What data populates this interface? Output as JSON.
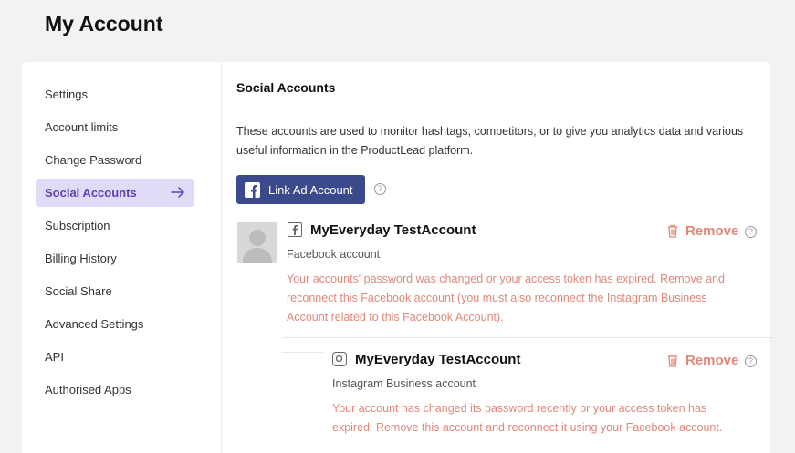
{
  "page": {
    "title": "My Account"
  },
  "sidebar": {
    "items": [
      {
        "label": "Settings"
      },
      {
        "label": "Account limits"
      },
      {
        "label": "Change Password"
      },
      {
        "label": "Social Accounts"
      },
      {
        "label": "Subscription"
      },
      {
        "label": "Billing History"
      },
      {
        "label": "Social Share"
      },
      {
        "label": "Advanced Settings"
      },
      {
        "label": "API"
      },
      {
        "label": "Authorised Apps"
      }
    ]
  },
  "main": {
    "title": "Social Accounts",
    "intro": "These accounts are used to monitor hashtags, competitors, or to give you analytics data and various useful information in the ProductLead platform.",
    "link_button": "Link Ad Account",
    "accounts": [
      {
        "name": "MyEveryday TestAccount",
        "type": "Facebook account",
        "warning": "Your accounts' password was changed or your access token has expired. Remove and reconnect this Facebook account (you must also reconnect the Instagram Business Account related to this Facebook Account).",
        "remove": "Remove",
        "icon": "facebook-icon"
      },
      {
        "name": "MyEveryday TestAccount",
        "type": "Instagram Business account",
        "warning": "Your account has changed its password recently or your access token has expired. Remove this account and reconnect it using your Facebook account.",
        "remove": "Remove",
        "icon": "instagram-icon"
      }
    ]
  },
  "colors": {
    "accent": "#5e3fb3",
    "active_bg": "#e0dbf6",
    "button": "#3b4a8a",
    "warning": "#e0877a"
  }
}
